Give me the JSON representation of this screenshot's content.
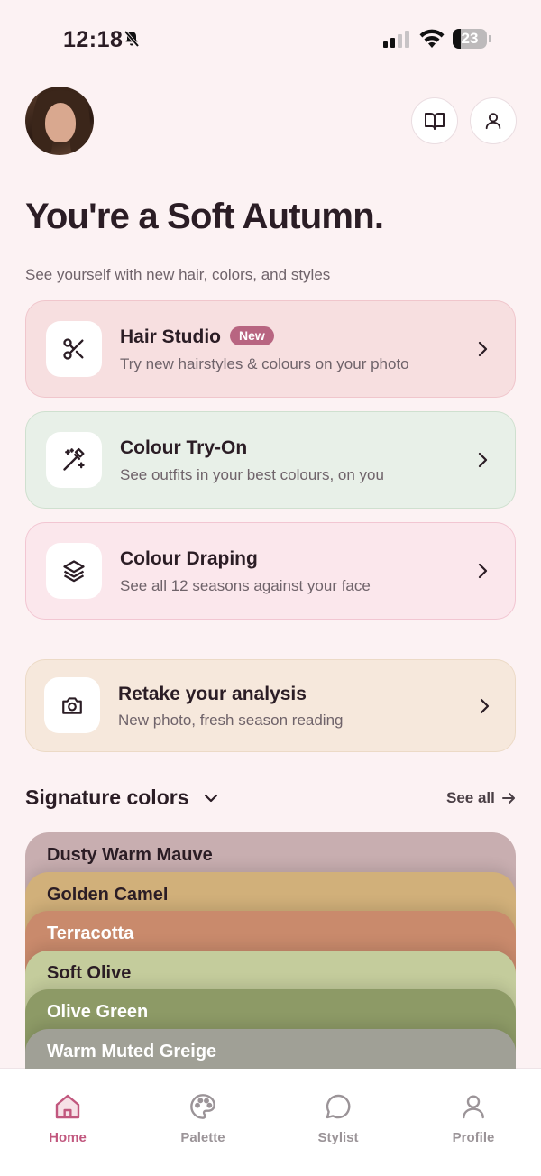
{
  "status_bar": {
    "time": "12:18",
    "battery": "23",
    "battery_level": 0.23
  },
  "header": {
    "title": "You're a Soft Autumn.",
    "subtitle": "See yourself with new hair, colors, and styles"
  },
  "cards": [
    {
      "title": "Hair Studio",
      "badge": "New",
      "description": "Try new hairstyles & colours on your photo"
    },
    {
      "title": "Colour Try-On",
      "description": "See outfits in your best colours, on you"
    },
    {
      "title": "Colour Draping",
      "description": "See all 12 seasons against your face"
    },
    {
      "title": "Retake your analysis",
      "description": "New photo, fresh season reading"
    }
  ],
  "signature": {
    "title": "Signature colors",
    "see_all": "See all",
    "colors": [
      {
        "name": "Dusty Warm Mauve",
        "hex": "#c8aeb0",
        "text": "#2b1d25"
      },
      {
        "name": "Golden Camel",
        "hex": "#d1b07a",
        "text": "#2b1d25"
      },
      {
        "name": "Terracotta",
        "hex": "#c98a6c",
        "text": "#ffffff"
      },
      {
        "name": "Soft Olive",
        "hex": "#c4cc9c",
        "text": "#2b1d25"
      },
      {
        "name": "Olive Green",
        "hex": "#8d9a66",
        "text": "#ffffff"
      },
      {
        "name": "Warm Muted Greige",
        "hex": "#a0a096",
        "text": "#ffffff"
      }
    ]
  },
  "tabs": [
    {
      "label": "Home",
      "active": true
    },
    {
      "label": "Palette"
    },
    {
      "label": "Stylist"
    },
    {
      "label": "Profile"
    }
  ],
  "colors": {
    "accent": "#c1577e",
    "badge": "#b86581",
    "background": "#fcf2f3"
  }
}
